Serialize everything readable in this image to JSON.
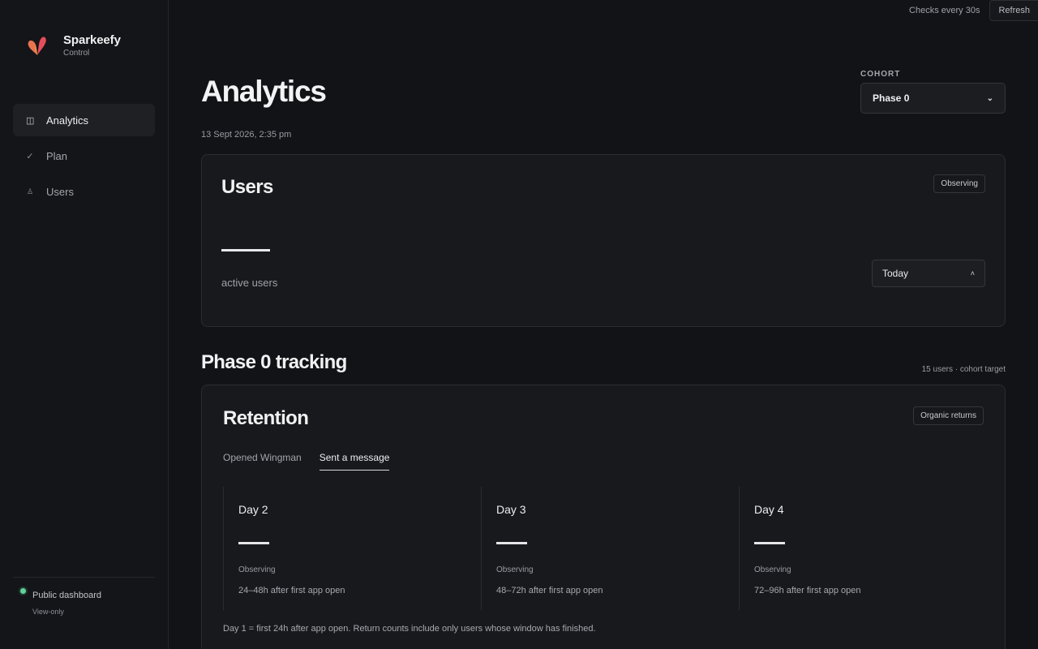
{
  "app": {
    "name": "Sparkeefy",
    "subtitle": "Control"
  },
  "sidebar": {
    "items": [
      {
        "label": "Analytics",
        "icon": "columns-icon",
        "active": true
      },
      {
        "label": "Plan",
        "icon": "check-icon",
        "active": false
      },
      {
        "label": "Users",
        "icon": "user-icon",
        "active": false
      }
    ],
    "footer": {
      "label": "Public dashboard",
      "sublabel": "View-only",
      "status_color": "#5fd39b"
    }
  },
  "topbar": {
    "checks": "Checks every 30s",
    "refresh_label": "Refresh"
  },
  "header": {
    "title": "Analytics",
    "timestamp": "13 Sept 2026, 2:35 pm",
    "cohort_label": "COHORT",
    "cohort_value": "Phase 0"
  },
  "users_card": {
    "title": "Users",
    "badge": "Observing",
    "metric_label": "active users",
    "range_value": "Today"
  },
  "tracking": {
    "title": "Phase 0 tracking",
    "note": "15 users · cohort target"
  },
  "retention": {
    "title": "Retention",
    "badge": "Organic returns",
    "tabs": [
      {
        "label": "Opened Wingman",
        "active": false
      },
      {
        "label": "Sent a message",
        "active": true
      }
    ],
    "days": [
      {
        "title": "Day 2",
        "status": "Observing",
        "desc": "24–48h after first app open"
      },
      {
        "title": "Day 3",
        "status": "Observing",
        "desc": "48–72h after first app open"
      },
      {
        "title": "Day 4",
        "status": "Observing",
        "desc": "72–96h after first app open"
      }
    ],
    "footnote": "Day 1 = first 24h after app open. Return counts include only users whose window has finished."
  }
}
